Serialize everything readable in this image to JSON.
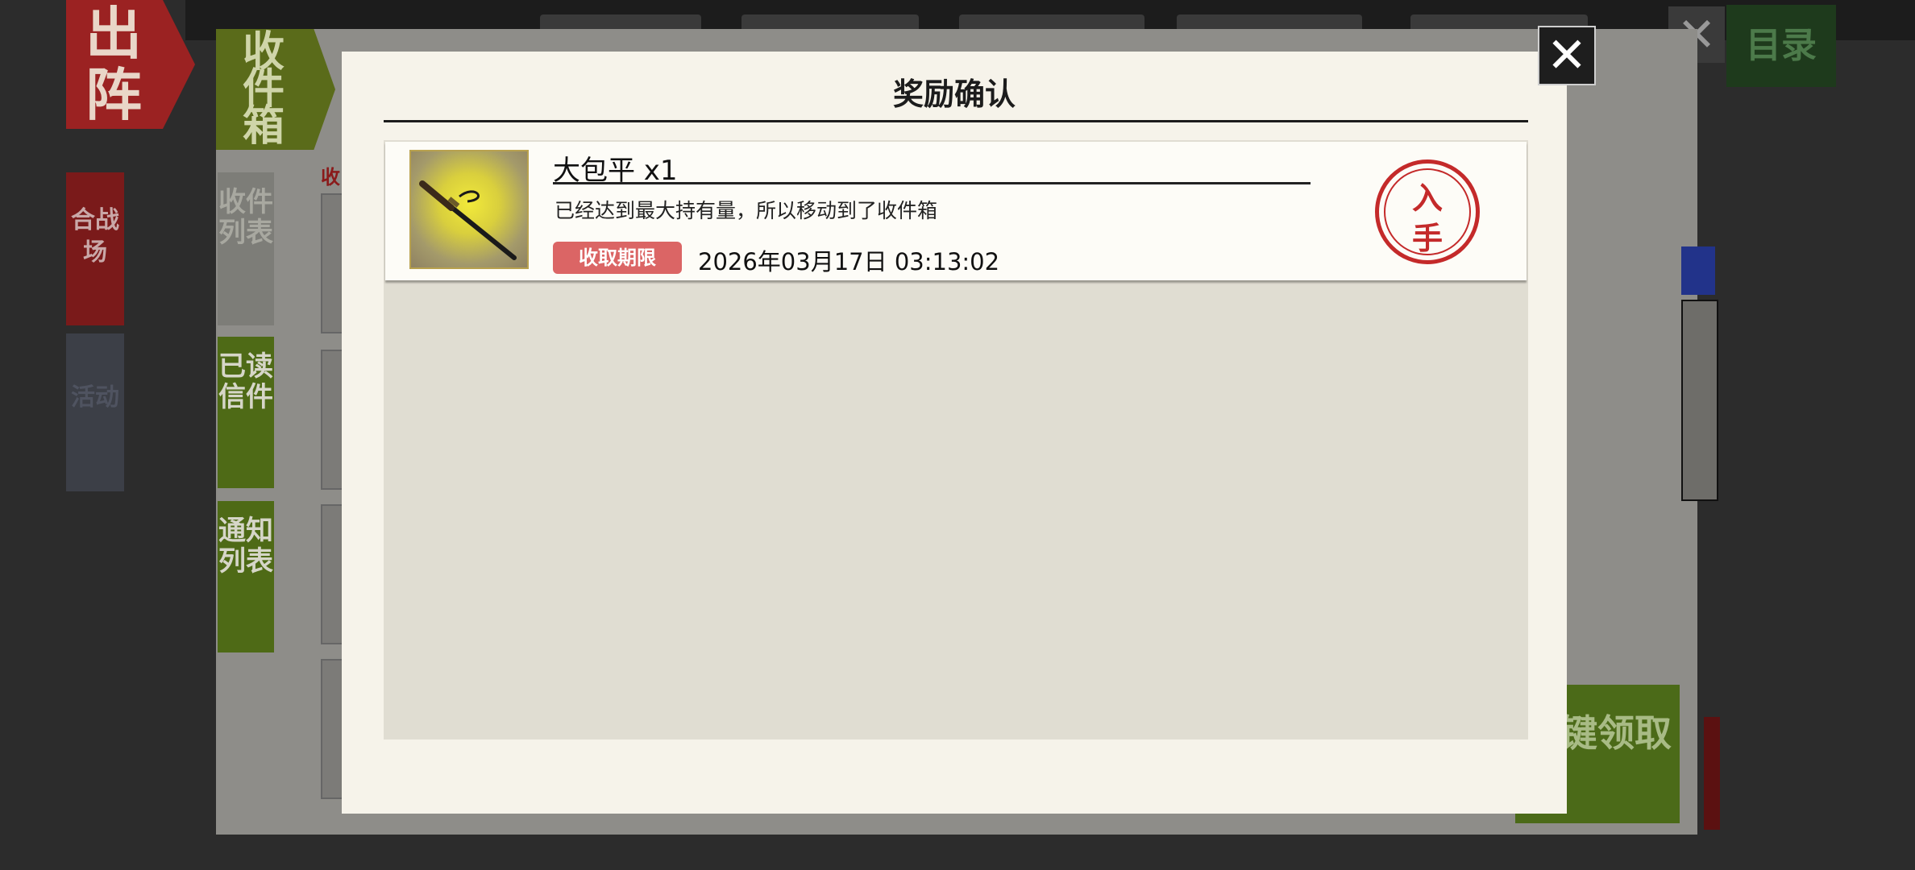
{
  "background": {
    "sortie_label": "出阵",
    "side_tabs": [
      "合战场",
      "活动"
    ],
    "catalog_label": "目录",
    "close_glyph": "✕"
  },
  "inbox": {
    "title": "收件箱",
    "tabs": [
      "收件列表",
      "已读信件",
      "通知列表"
    ],
    "list_label": "收",
    "claim_all_label": "一键领取"
  },
  "dialog": {
    "title": "奖励确认",
    "close_glyph": "✕",
    "items": [
      {
        "name": "大包平 x1",
        "description": "已经达到最大持有量，所以移动到了收件箱",
        "deadline_label": "收取期限",
        "deadline_value": "2026年03月17日 03:13:02",
        "stamp_line1": "入",
        "stamp_line2": "手",
        "icon": "katana-icon"
      }
    ]
  },
  "colors": {
    "dialog_bg": "#f6f3ea",
    "list_bg": "#e0ddd2",
    "badge": "#db6565",
    "stamp": "#c42a2a",
    "inbox_green": "#4e6a16"
  }
}
